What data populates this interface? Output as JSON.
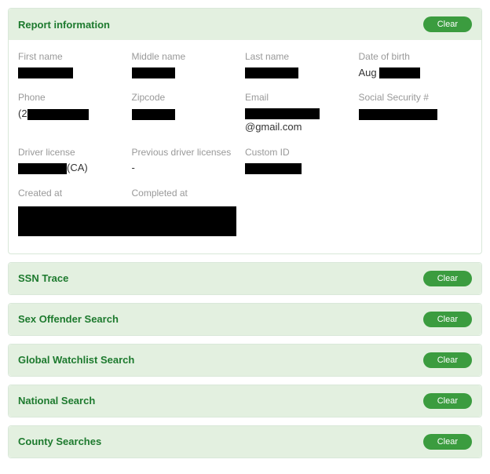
{
  "panels": {
    "report_info": {
      "title": "Report information",
      "clear": "Clear"
    },
    "ssn_trace": {
      "title": "SSN Trace",
      "clear": "Clear"
    },
    "sex_offender": {
      "title": "Sex Offender Search",
      "clear": "Clear"
    },
    "global_watchlist": {
      "title": "Global Watchlist Search",
      "clear": "Clear"
    },
    "national_search": {
      "title": "National Search",
      "clear": "Clear"
    },
    "county_searches": {
      "title": "County Searches",
      "clear": "Clear"
    }
  },
  "fields": {
    "first_name": {
      "label": "First name",
      "value": ""
    },
    "middle_name": {
      "label": "Middle name",
      "value": ""
    },
    "last_name": {
      "label": "Last name",
      "value": ""
    },
    "dob": {
      "label": "Date of birth",
      "prefix": "Aug "
    },
    "phone": {
      "label": "Phone",
      "prefix": "(2"
    },
    "zipcode": {
      "label": "Zipcode",
      "value": ""
    },
    "email": {
      "label": "Email",
      "suffix": "@gmail.com"
    },
    "ssn": {
      "label": "Social Security #",
      "value": ""
    },
    "driver_license": {
      "label": "Driver license",
      "suffix": "(CA)"
    },
    "prev_driver_licenses": {
      "label": "Previous driver licenses",
      "value": "-"
    },
    "custom_id": {
      "label": "Custom ID",
      "value": ""
    },
    "created_at": {
      "label": "Created at",
      "value": ""
    },
    "completed_at": {
      "label": "Completed at",
      "value": ""
    }
  }
}
